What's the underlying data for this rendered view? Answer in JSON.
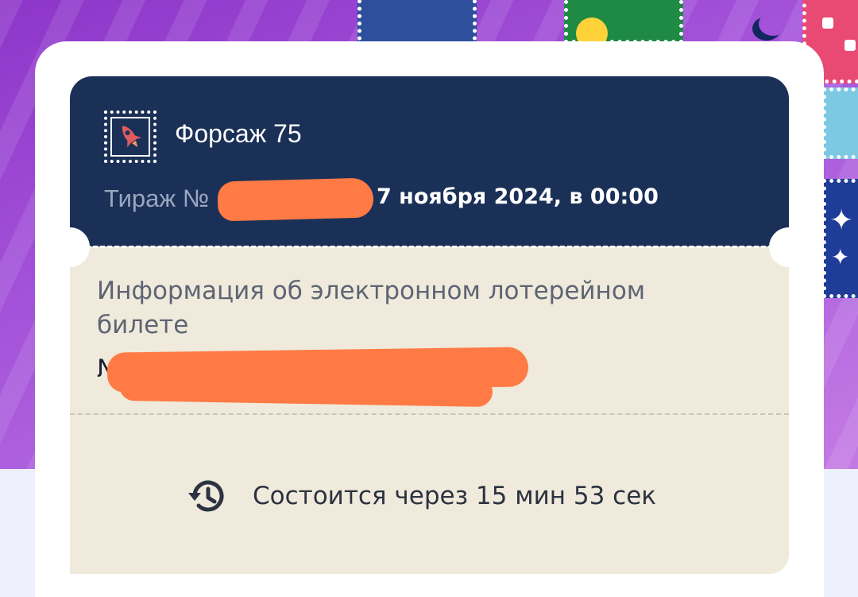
{
  "ticket": {
    "game_name": "Форсаж 75",
    "draw_label": "Тираж №",
    "draw_datetime": "7 ноября 2024, в 00:00",
    "info_heading": "Информация об электронном лотерейном билете",
    "number_label": "№",
    "countdown_text": "Состоится через 15 мин 53 сек",
    "icons": {
      "game": "rocket-icon",
      "countdown": "history-clock-icon"
    }
  },
  "colors": {
    "header_bg": "#1a3057",
    "body_bg": "#efeadb",
    "redaction": "#ff7a45",
    "background_purple": "#a14fd8"
  }
}
